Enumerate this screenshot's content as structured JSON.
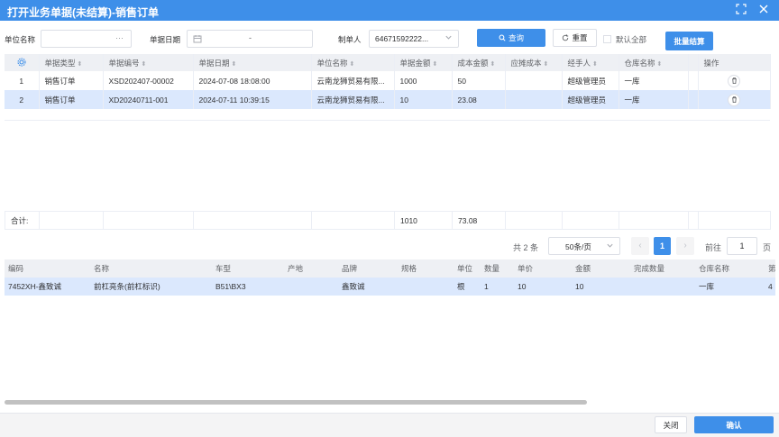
{
  "window": {
    "title": "打开业务单据(未结算)-销售订单"
  },
  "filter": {
    "unit_label": "单位名称",
    "unit_dots": "···",
    "date_label": "单据日期",
    "date_sep": "-",
    "creator_label": "制单人",
    "creator_value": "64671592222...",
    "query_label": "查询",
    "reset_label": "重置",
    "default_all_label": "默认全部",
    "batch_label": "批量结算"
  },
  "grid": {
    "headers": [
      "单据类型",
      "单据编号",
      "单据日期",
      "单位名称",
      "单据金额",
      "成本金额",
      "应摊成本",
      "经手人",
      "仓库名称",
      "操作"
    ],
    "rows": [
      {
        "idx": "1",
        "type": "销售订单",
        "no": "XSD202407-00002",
        "date": "2024-07-08 18:08:00",
        "unit": "云南龙狮贸易有限...",
        "amount": "1000",
        "cost": "50",
        "alloc": "",
        "handler": "超级管理员",
        "warehouse": "一库"
      },
      {
        "idx": "2",
        "type": "销售订单",
        "no": "XD20240711-001",
        "date": "2024-07-11 10:39:15",
        "unit": "云南龙狮贸易有限...",
        "amount": "10",
        "cost": "23.08",
        "alloc": "",
        "handler": "超级管理员",
        "warehouse": "一库"
      }
    ],
    "sum_label": "合计:",
    "sum_amount": "1010",
    "sum_cost": "73.08"
  },
  "pager": {
    "total": "共 2 条",
    "page_size": "50条/页",
    "current": "1",
    "goto_label": "前往",
    "goto_value": "1",
    "page_unit": "页"
  },
  "detail": {
    "headers": [
      "编码",
      "名称",
      "车型",
      "产地",
      "品牌",
      "规格",
      "单位",
      "数量",
      "单价",
      "金额",
      "完成数量",
      "仓库名称",
      "第"
    ],
    "row": {
      "code": "7452XH-鑫致诚",
      "name": "前杠亮条(前杠标识)",
      "model": "B51\\BX3",
      "origin": "",
      "brand": "鑫致诚",
      "spec": "",
      "unit": "根",
      "qty": "1",
      "price": "10",
      "amount": "10",
      "done": "",
      "warehouse": "一库",
      "extra": "4"
    }
  },
  "footer": {
    "close_label": "关闭",
    "confirm_label": "确认"
  },
  "colors": {
    "primary": "#3e8fe9",
    "selected_row": "#dbe8fd"
  }
}
